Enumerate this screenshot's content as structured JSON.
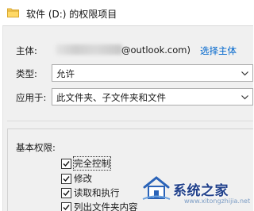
{
  "window": {
    "title": "软件 (D:) 的权限项目"
  },
  "owner": {
    "label": "主体:",
    "email_suffix": "@outlook.com)",
    "change_link": "选择主体"
  },
  "type": {
    "label": "类型:",
    "value": "允许"
  },
  "applies_to": {
    "label": "应用于:",
    "value": "此文件夹、子文件夹和文件"
  },
  "basic_permissions": {
    "heading": "基本权限:",
    "items": [
      {
        "label": "完全控制",
        "checked": true
      },
      {
        "label": "修改",
        "checked": true
      },
      {
        "label": "读取和执行",
        "checked": true
      },
      {
        "label": "列出文件夹内容",
        "checked": true
      }
    ]
  },
  "watermark": {
    "text": "系统之家",
    "url": "www.xitongzhijia.net"
  },
  "colors": {
    "link": "#0066cc",
    "panel_bg": "#f0f0f0",
    "watermark": "#1f3f8a"
  },
  "icons": [
    "folder-icon",
    "chevron-down-icon",
    "checkmark-icon",
    "logo-house-icon"
  ]
}
